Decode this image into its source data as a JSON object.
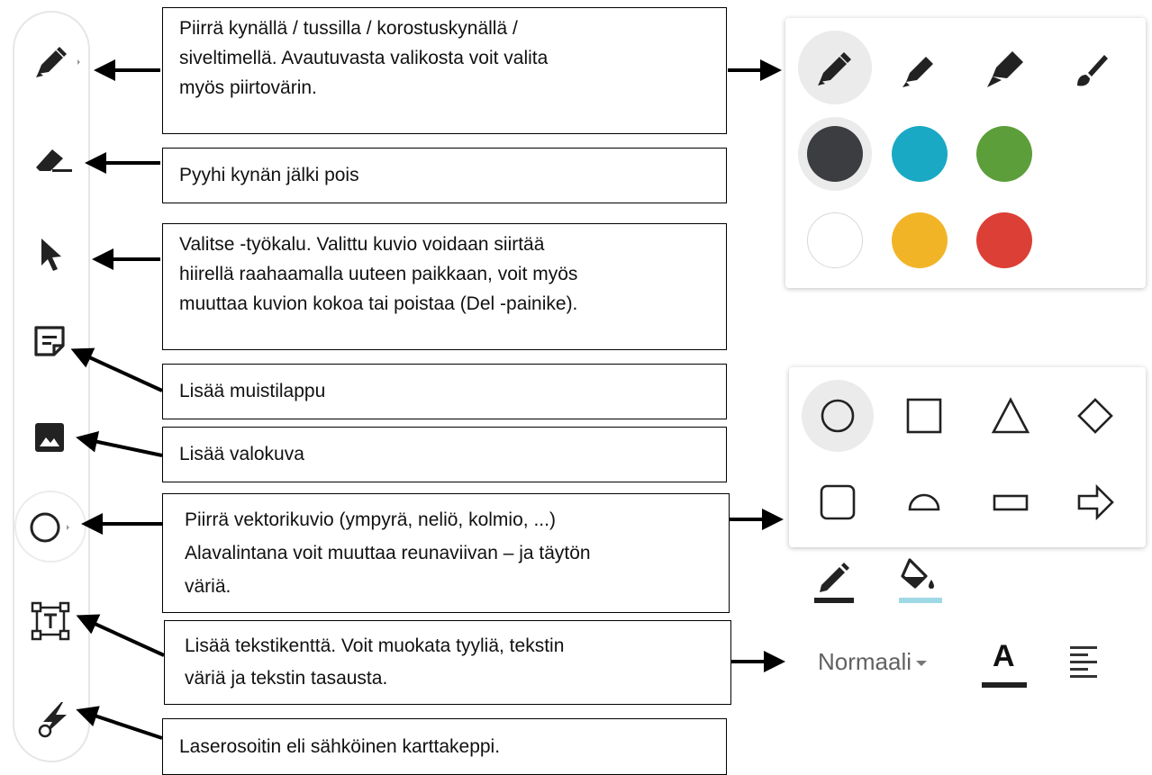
{
  "annotations": {
    "pen": "Piirrä kynällä / tussilla / korostuskynällä /\nsiveltimellä. Avautuvasta valikosta voit valita\nmyös piirtovärin.",
    "eraser": "Pyyhi kynän jälki pois",
    "select": "Valitse -työkalu. Valittu kuvio voidaan siirtää\nhiirellä raahaamalla uuteen paikkaan, voit myös\nmuuttaa kuvion kokoa tai poistaa (Del -painike).",
    "sticky": "Lisää muistilappu",
    "image": "Lisää valokuva",
    "shape": "Piirrä vektorikuvio (ympyrä, neliö, kolmio, ...)\nAlavalintana voit muuttaa reunaviivan – ja täytön\nväriä.",
    "textbox": "Lisää tekstikenttä. Voit muokata tyyliä, tekstin\nväriä ja tekstin tasausta.",
    "laser": "Laserosoitin eli sähköinen karttakeppi."
  },
  "toolbar": {
    "tools": [
      "pen-tool",
      "eraser-tool",
      "select-tool",
      "sticky-note-tool",
      "image-tool",
      "shape-tool",
      "text-box-tool",
      "laser-pointer-tool"
    ]
  },
  "pen_panel": {
    "pens": [
      "pen-icon",
      "marker-icon",
      "highlighter-icon",
      "brush-icon"
    ],
    "colors": [
      "#3b3d40",
      "#1aa9c4",
      "#5c9e3a",
      "#ffffff",
      "#f2b427",
      "#dc3f35"
    ],
    "selected_pen": "pen-icon",
    "selected_color": "#3b3d40"
  },
  "shape_panel": {
    "shapes": [
      "circle-icon",
      "square-icon",
      "triangle-icon",
      "diamond-icon",
      "rounded-square-icon",
      "semicircle-icon",
      "rectangle-icon",
      "arrow-right-icon"
    ],
    "selected_shape": "circle-icon"
  },
  "shape_styles": {
    "border_color": "#212121",
    "fill_color": "#9fd9e6"
  },
  "text_panel": {
    "style_label": "Normaali",
    "text_color_glyph": "A",
    "text_color": "#212121"
  }
}
